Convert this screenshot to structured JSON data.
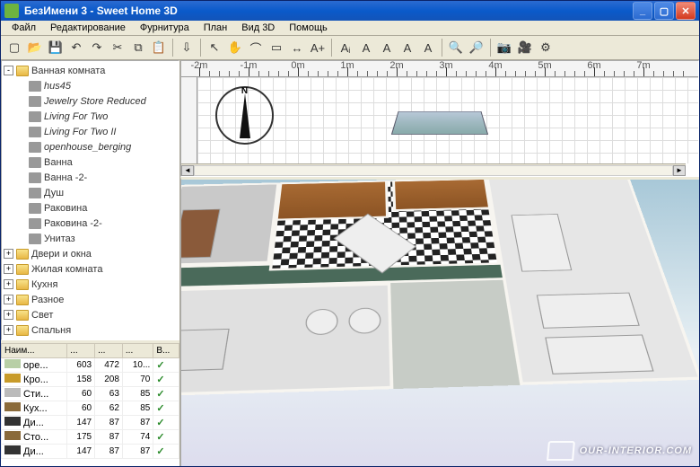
{
  "window": {
    "title": "БезИмени 3 - Sweet Home 3D"
  },
  "menubar": [
    "Файл",
    "Редактирование",
    "Фурнитура",
    "План",
    "Вид 3D",
    "Помощь"
  ],
  "toolbar_icons": [
    "new-file-icon",
    "open-file-icon",
    "save-icon",
    "undo-icon",
    "redo-icon",
    "cut-icon",
    "copy-icon",
    "paste-icon",
    "sep",
    "import-icon",
    "sep",
    "pointer-icon",
    "pan-icon",
    "wall-icon",
    "room-icon",
    "dimension-icon",
    "text-icon",
    "sep",
    "select-icon",
    "text-bold-icon",
    "text-italic-icon",
    "text-size-icon",
    "text-a-icon",
    "sep",
    "zoom-in-icon",
    "zoom-out-icon",
    "sep",
    "snapshot-icon",
    "camera-icon",
    "settings-icon"
  ],
  "toolbar_glyphs": [
    "▢",
    "📂",
    "💾",
    "↶",
    "↷",
    "✂",
    "⧉",
    "📋",
    "",
    "⇩",
    "",
    "↖",
    "✋",
    "⌒",
    "▭",
    "↔",
    "A+",
    "",
    "Aᵢ",
    "A",
    "A",
    "A",
    "A",
    "",
    "🔍",
    "🔎",
    "",
    "📷",
    "🎥",
    "⚙"
  ],
  "tree": {
    "root": "Ванная комната",
    "children": [
      "hus45",
      "Jewelry Store Reduced",
      "Living For Two",
      "Living For Two II",
      "openhouse_berging",
      "Ванна",
      "Ванна -2-",
      "Душ",
      "Раковина",
      "Раковина -2-",
      "Унитаз"
    ],
    "siblings": [
      "Двери и окна",
      "Жилая комната",
      "Кухня",
      "Разное",
      "Свет",
      "Спальня"
    ]
  },
  "table": {
    "headers": [
      "Наим...",
      "...",
      "...",
      "...",
      "В..."
    ],
    "rows": [
      {
        "icon": "#b8cfa6",
        "name": "оре...",
        "w": "603",
        "h": "472",
        "d": "10...",
        "v": true
      },
      {
        "icon": "#c89b2a",
        "name": "Кро...",
        "w": "158",
        "h": "208",
        "d": "70",
        "v": true
      },
      {
        "icon": "#bbb",
        "name": "Сти...",
        "w": "60",
        "h": "63",
        "d": "85",
        "v": true
      },
      {
        "icon": "#8a6a3a",
        "name": "Кух...",
        "w": "60",
        "h": "62",
        "d": "85",
        "v": true
      },
      {
        "icon": "#333",
        "name": "Ди...",
        "w": "147",
        "h": "87",
        "d": "87",
        "v": true
      },
      {
        "icon": "#8a6a3a",
        "name": "Сто...",
        "w": "175",
        "h": "87",
        "d": "74",
        "v": true
      },
      {
        "icon": "#333",
        "name": "Ди...",
        "w": "147",
        "h": "87",
        "d": "87",
        "v": true
      }
    ]
  },
  "ruler": {
    "labels": [
      "-2m",
      "-1m",
      "0m",
      "1m",
      "2m",
      "3m",
      "4m",
      "5m",
      "6m",
      "7m"
    ]
  },
  "compass": {
    "label": "N"
  },
  "watermark": "OUR-INTERIOR.COM"
}
